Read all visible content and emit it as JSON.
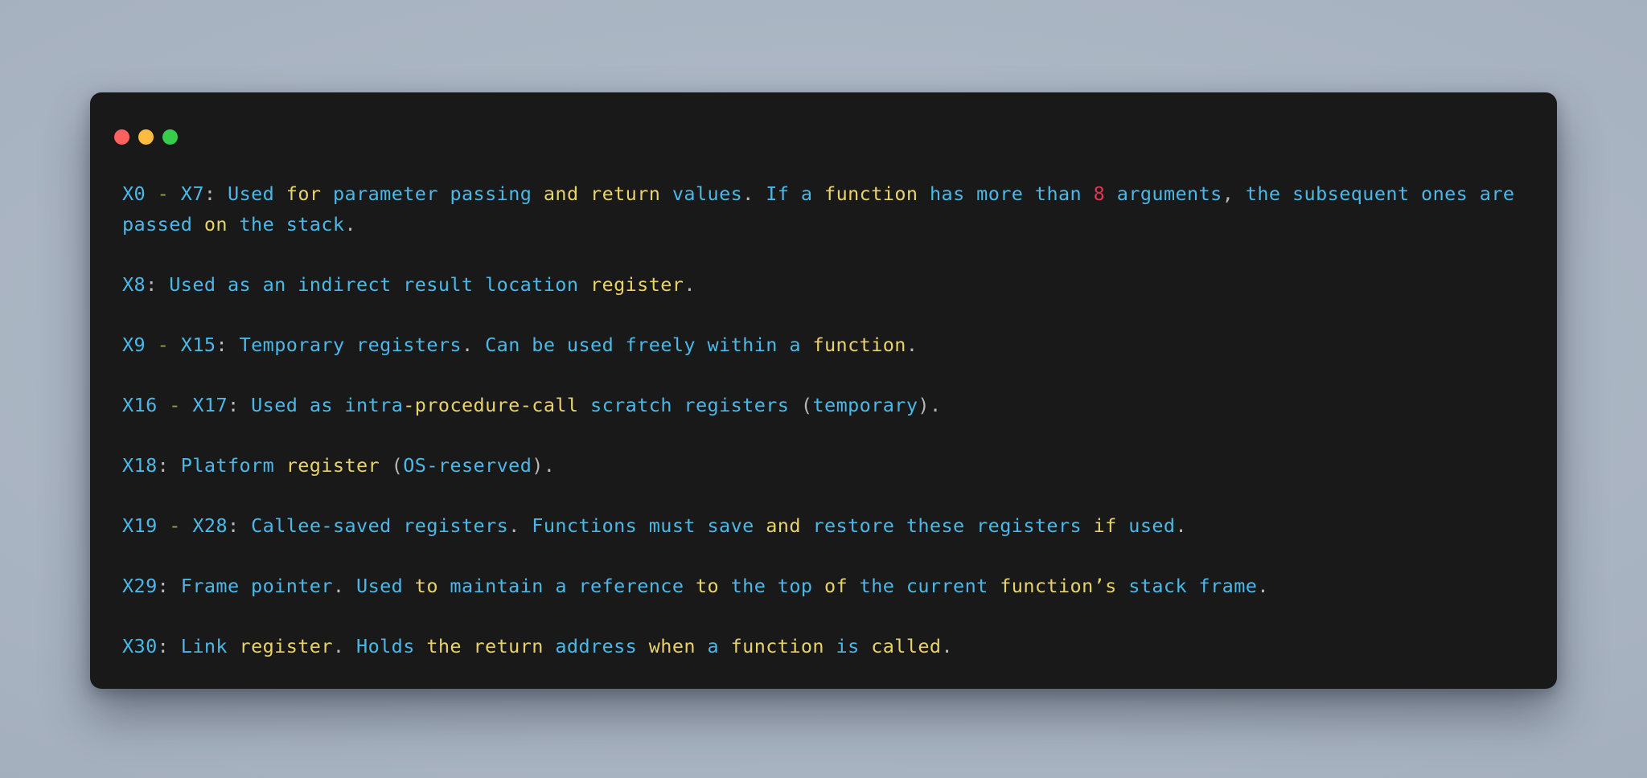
{
  "window": {
    "title": "terminal-code-window",
    "background_color": "#191919",
    "page_background_color": "#a9b4c2",
    "traffic_lights": [
      {
        "name": "close",
        "color": "#fc625d"
      },
      {
        "name": "minimize",
        "color": "#fdbc40"
      },
      {
        "name": "maximize",
        "color": "#35cd4b"
      }
    ]
  },
  "palette": {
    "blue": "#4bb8e8",
    "yellow": "#e8d26a",
    "red": "#e0364f",
    "punctuation": "#b9b9b9",
    "dash": "#9aa046"
  },
  "content": {
    "plain_text": "X0 - X7: Used for parameter passing and return values. If a function has more than 8 arguments, the subsequent ones are passed on the stack.\n\nX8: Used as an indirect result location register.\n\nX9 - X15: Temporary registers. Can be used freely within a function.\n\nX16 - X17: Used as intra-procedure-call scratch registers (temporary).\n\nX18: Platform register (OS-reserved).\n\nX19 - X28: Callee-saved registers. Functions must save and restore these registers if used.\n\nX29: Frame pointer. Used to maintain a reference to the top of the current function’s stack frame.\n\nX30: Link register. Holds the return address when a function is called.",
    "lines": [
      {
        "id": "line-x0-x7",
        "tokens": [
          {
            "t": "X0",
            "c": "blue"
          },
          {
            "t": " ",
            "c": "punct"
          },
          {
            "t": "-",
            "c": "dash"
          },
          {
            "t": " ",
            "c": "punct"
          },
          {
            "t": "X7",
            "c": "blue"
          },
          {
            "t": ":",
            "c": "punct"
          },
          {
            "t": " Used ",
            "c": "blue"
          },
          {
            "t": "for",
            "c": "yellow"
          },
          {
            "t": " parameter passing ",
            "c": "blue"
          },
          {
            "t": "and return",
            "c": "yellow"
          },
          {
            "t": " values",
            "c": "blue"
          },
          {
            "t": ". ",
            "c": "punct"
          },
          {
            "t": "If a ",
            "c": "blue"
          },
          {
            "t": "function",
            "c": "yellow"
          },
          {
            "t": " has more than ",
            "c": "blue"
          },
          {
            "t": "8",
            "c": "red"
          },
          {
            "t": " arguments",
            "c": "blue"
          },
          {
            "t": ", ",
            "c": "punct"
          },
          {
            "t": "the subsequent ones are passed ",
            "c": "blue"
          },
          {
            "t": "on",
            "c": "yellow"
          },
          {
            "t": " the stack",
            "c": "blue"
          },
          {
            "t": ".",
            "c": "punct"
          }
        ]
      },
      {
        "id": "line-x8",
        "tokens": [
          {
            "t": "X8",
            "c": "blue"
          },
          {
            "t": ":",
            "c": "punct"
          },
          {
            "t": " Used as an indirect result location ",
            "c": "blue"
          },
          {
            "t": "register",
            "c": "yellow"
          },
          {
            "t": ".",
            "c": "punct"
          }
        ]
      },
      {
        "id": "line-x9-x15",
        "tokens": [
          {
            "t": "X9",
            "c": "blue"
          },
          {
            "t": " ",
            "c": "punct"
          },
          {
            "t": "-",
            "c": "dash"
          },
          {
            "t": " ",
            "c": "punct"
          },
          {
            "t": "X15",
            "c": "blue"
          },
          {
            "t": ":",
            "c": "punct"
          },
          {
            "t": " Temporary registers",
            "c": "blue"
          },
          {
            "t": ". ",
            "c": "punct"
          },
          {
            "t": "Can be used freely within a ",
            "c": "blue"
          },
          {
            "t": "function",
            "c": "yellow"
          },
          {
            "t": ".",
            "c": "punct"
          }
        ]
      },
      {
        "id": "line-x16-x17",
        "tokens": [
          {
            "t": "X16",
            "c": "blue"
          },
          {
            "t": " ",
            "c": "punct"
          },
          {
            "t": "-",
            "c": "dash"
          },
          {
            "t": " ",
            "c": "punct"
          },
          {
            "t": "X17",
            "c": "blue"
          },
          {
            "t": ":",
            "c": "punct"
          },
          {
            "t": " Used as intra",
            "c": "blue"
          },
          {
            "t": "-procedure-call",
            "c": "yellow"
          },
          {
            "t": " scratch registers ",
            "c": "blue"
          },
          {
            "t": "(",
            "c": "punct"
          },
          {
            "t": "temporary",
            "c": "blue"
          },
          {
            "t": ").",
            "c": "punct"
          }
        ]
      },
      {
        "id": "line-x18",
        "tokens": [
          {
            "t": "X18",
            "c": "blue"
          },
          {
            "t": ":",
            "c": "punct"
          },
          {
            "t": " Platform ",
            "c": "blue"
          },
          {
            "t": "register",
            "c": "yellow"
          },
          {
            "t": " ",
            "c": "blue"
          },
          {
            "t": "(",
            "c": "punct"
          },
          {
            "t": "OS-reserved",
            "c": "blue"
          },
          {
            "t": ").",
            "c": "punct"
          }
        ]
      },
      {
        "id": "line-x19-x28",
        "tokens": [
          {
            "t": "X19",
            "c": "blue"
          },
          {
            "t": " ",
            "c": "punct"
          },
          {
            "t": "-",
            "c": "dash"
          },
          {
            "t": " ",
            "c": "punct"
          },
          {
            "t": "X28",
            "c": "blue"
          },
          {
            "t": ":",
            "c": "punct"
          },
          {
            "t": " Callee-saved registers",
            "c": "blue"
          },
          {
            "t": ". ",
            "c": "punct"
          },
          {
            "t": "Functions must save ",
            "c": "blue"
          },
          {
            "t": "and",
            "c": "yellow"
          },
          {
            "t": " restore these registers ",
            "c": "blue"
          },
          {
            "t": "if",
            "c": "yellow"
          },
          {
            "t": " used",
            "c": "blue"
          },
          {
            "t": ".",
            "c": "punct"
          }
        ]
      },
      {
        "id": "line-x29",
        "tokens": [
          {
            "t": "X29",
            "c": "blue"
          },
          {
            "t": ":",
            "c": "punct"
          },
          {
            "t": " Frame pointer",
            "c": "blue"
          },
          {
            "t": ". ",
            "c": "punct"
          },
          {
            "t": "Used ",
            "c": "blue"
          },
          {
            "t": "to",
            "c": "yellow"
          },
          {
            "t": " maintain a reference ",
            "c": "blue"
          },
          {
            "t": "to",
            "c": "yellow"
          },
          {
            "t": " the top ",
            "c": "blue"
          },
          {
            "t": "of",
            "c": "yellow"
          },
          {
            "t": " the current ",
            "c": "blue"
          },
          {
            "t": "function’s",
            "c": "yellow"
          },
          {
            "t": " stack frame",
            "c": "blue"
          },
          {
            "t": ".",
            "c": "punct"
          }
        ]
      },
      {
        "id": "line-x30",
        "tokens": [
          {
            "t": "X30",
            "c": "blue"
          },
          {
            "t": ":",
            "c": "punct"
          },
          {
            "t": " Link ",
            "c": "blue"
          },
          {
            "t": "register",
            "c": "yellow"
          },
          {
            "t": ". ",
            "c": "punct"
          },
          {
            "t": "Holds ",
            "c": "blue"
          },
          {
            "t": "the return",
            "c": "yellow"
          },
          {
            "t": " address ",
            "c": "blue"
          },
          {
            "t": "when",
            "c": "yellow"
          },
          {
            "t": " a ",
            "c": "blue"
          },
          {
            "t": "function",
            "c": "yellow"
          },
          {
            "t": " is ",
            "c": "blue"
          },
          {
            "t": "called",
            "c": "yellow"
          },
          {
            "t": ".",
            "c": "punct"
          }
        ]
      }
    ]
  }
}
